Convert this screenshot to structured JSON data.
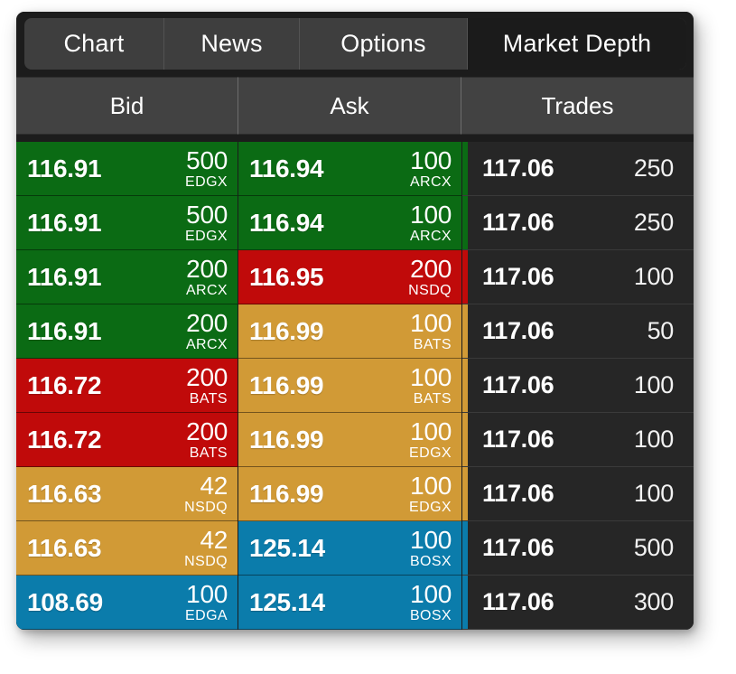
{
  "window": {
    "background_color": "#ffffff",
    "panel_color": "#1c1c1c"
  },
  "tabs": [
    {
      "label": "Chart",
      "active": false,
      "width_class": "w-chart"
    },
    {
      "label": "News",
      "active": false,
      "width_class": "w-news"
    },
    {
      "label": "Options",
      "active": false,
      "width_class": "w-options"
    },
    {
      "label": "Market Depth",
      "active": true,
      "width_class": "w-depth"
    }
  ],
  "columns": {
    "bid": "Bid",
    "ask": "Ask",
    "trades": "Trades"
  },
  "colors": {
    "green": "#0b6b14",
    "red": "#c00a0a",
    "gold": "#d19a36",
    "blue": "#0b7cab",
    "trade_cell": "#262626",
    "header": "#424242",
    "tab_strip": "#3e3e3e",
    "tab_active": "#1b1b1b"
  },
  "chart_data": {
    "type": "table",
    "title": "Market Depth",
    "columns": [
      "Bid",
      "Ask",
      "Trades"
    ],
    "bid": [
      {
        "price": "116.91",
        "size": "500",
        "venue": "EDGX",
        "color": "#0b6b14"
      },
      {
        "price": "116.91",
        "size": "500",
        "venue": "EDGX",
        "color": "#0b6b14"
      },
      {
        "price": "116.91",
        "size": "200",
        "venue": "ARCX",
        "color": "#0b6b14"
      },
      {
        "price": "116.91",
        "size": "200",
        "venue": "ARCX",
        "color": "#0b6b14"
      },
      {
        "price": "116.72",
        "size": "200",
        "venue": "BATS",
        "color": "#c00a0a"
      },
      {
        "price": "116.72",
        "size": "200",
        "venue": "BATS",
        "color": "#c00a0a"
      },
      {
        "price": "116.63",
        "size": "42",
        "venue": "NSDQ",
        "color": "#d19a36"
      },
      {
        "price": "116.63",
        "size": "42",
        "venue": "NSDQ",
        "color": "#d19a36"
      },
      {
        "price": "108.69",
        "size": "100",
        "venue": "EDGA",
        "color": "#0b7cab"
      }
    ],
    "ask": [
      {
        "price": "116.94",
        "size": "100",
        "venue": "ARCX",
        "color": "#0b6b14"
      },
      {
        "price": "116.94",
        "size": "100",
        "venue": "ARCX",
        "color": "#0b6b14"
      },
      {
        "price": "116.95",
        "size": "200",
        "venue": "NSDQ",
        "color": "#c00a0a"
      },
      {
        "price": "116.99",
        "size": "100",
        "venue": "BATS",
        "color": "#d19a36"
      },
      {
        "price": "116.99",
        "size": "100",
        "venue": "BATS",
        "color": "#d19a36"
      },
      {
        "price": "116.99",
        "size": "100",
        "venue": "EDGX",
        "color": "#d19a36"
      },
      {
        "price": "116.99",
        "size": "100",
        "venue": "EDGX",
        "color": "#d19a36"
      },
      {
        "price": "125.14",
        "size": "100",
        "venue": "BOSX",
        "color": "#0b7cab"
      },
      {
        "price": "125.14",
        "size": "100",
        "venue": "BOSX",
        "color": "#0b7cab"
      }
    ],
    "trades": [
      {
        "price": "117.06",
        "size": "250",
        "edge_color": "#0b6b14"
      },
      {
        "price": "117.06",
        "size": "250",
        "edge_color": "#0b6b14"
      },
      {
        "price": "117.06",
        "size": "100",
        "edge_color": "#c00a0a"
      },
      {
        "price": "117.06",
        "size": "50",
        "edge_color": "#d19a36"
      },
      {
        "price": "117.06",
        "size": "100",
        "edge_color": "#d19a36"
      },
      {
        "price": "117.06",
        "size": "100",
        "edge_color": "#d19a36"
      },
      {
        "price": "117.06",
        "size": "100",
        "edge_color": "#d19a36"
      },
      {
        "price": "117.06",
        "size": "500",
        "edge_color": "#0b7cab"
      },
      {
        "price": "117.06",
        "size": "300",
        "edge_color": "#0b7cab"
      }
    ]
  }
}
